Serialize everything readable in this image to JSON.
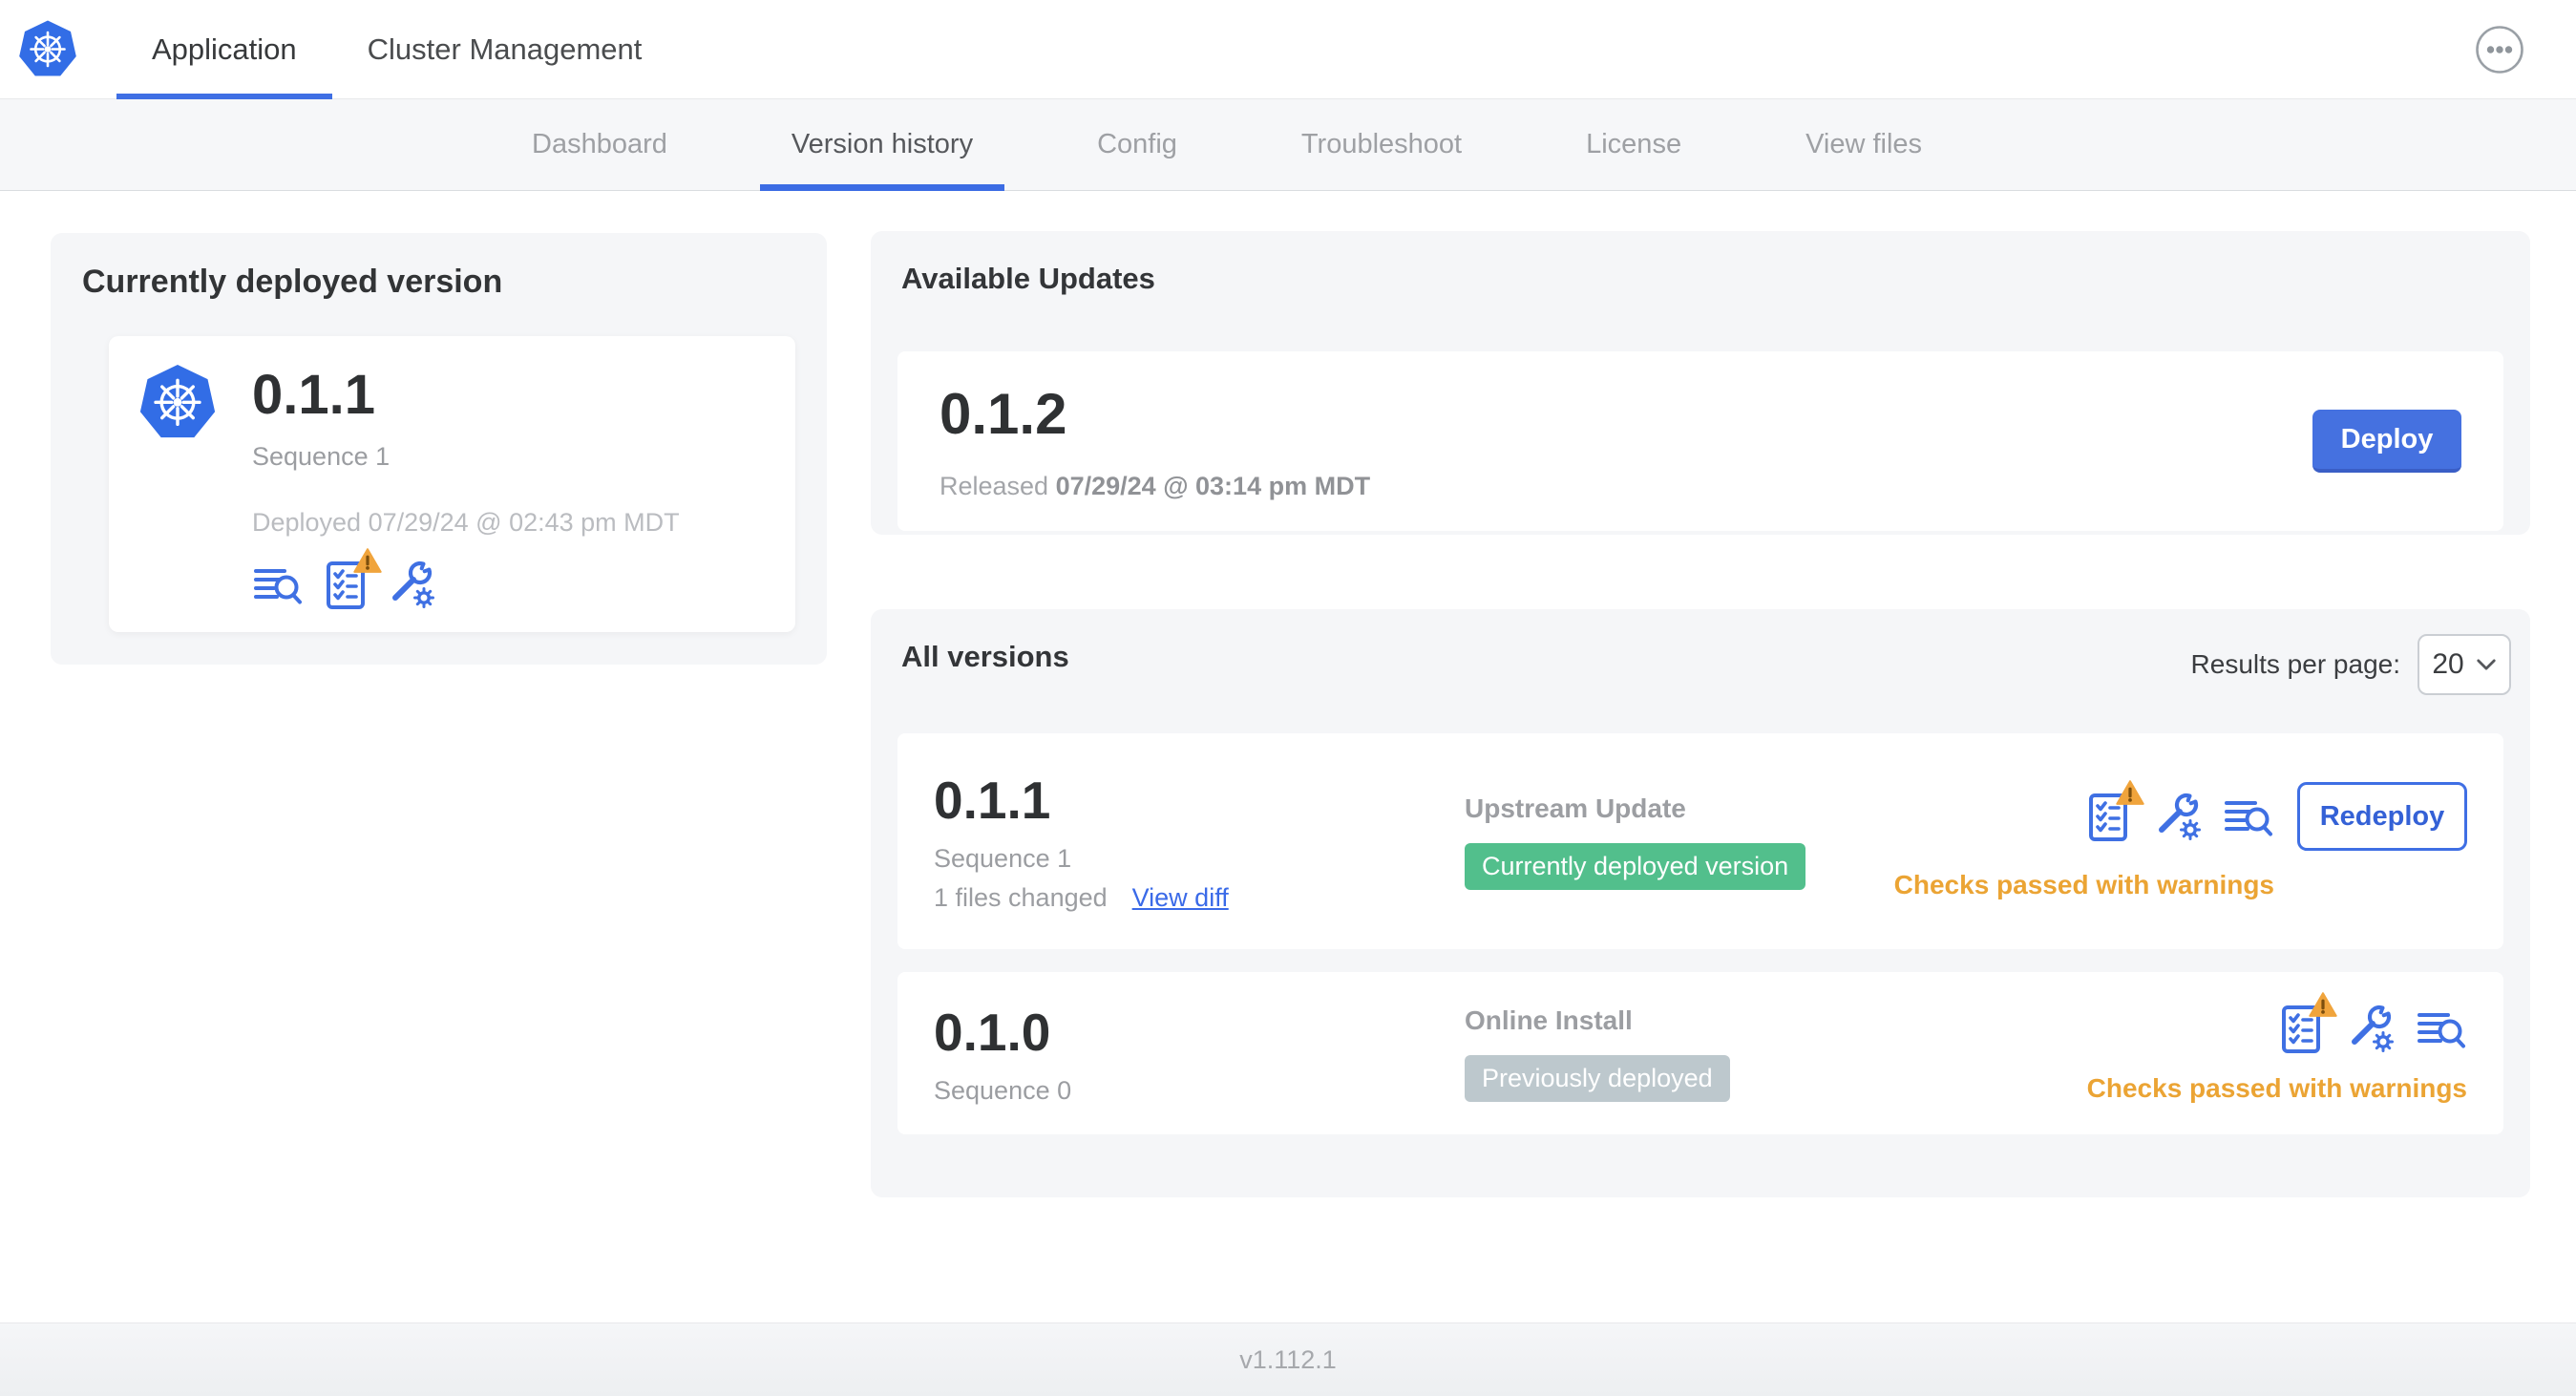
{
  "header": {
    "tabs": [
      {
        "label": "Application",
        "active": true
      },
      {
        "label": "Cluster Management",
        "active": false
      }
    ],
    "menu_icon": "ellipsis-menu-icon",
    "logo_icon": "kubernetes-logo"
  },
  "subnav": {
    "items": [
      {
        "label": "Dashboard",
        "active": false
      },
      {
        "label": "Version history",
        "active": true
      },
      {
        "label": "Config",
        "active": false
      },
      {
        "label": "Troubleshoot",
        "active": false
      },
      {
        "label": "License",
        "active": false
      },
      {
        "label": "View files",
        "active": false
      }
    ]
  },
  "deployed_card": {
    "title": "Currently deployed version",
    "version": "0.1.1",
    "sequence": "Sequence 1",
    "deployed_at": "Deployed 07/29/24 @ 02:43 pm MDT",
    "icons": [
      "release-notes-icon",
      "preflight-checks-warning-icon",
      "config-values-icon"
    ]
  },
  "available_updates": {
    "title": "Available Updates",
    "version": "0.1.2",
    "released_prefix": "Released",
    "released_date": "07/29/24 @ 03:14 pm MDT",
    "deploy_label": "Deploy"
  },
  "all_versions": {
    "title": "All versions",
    "results_per_page_label": "Results per page:",
    "results_per_page_value": "20",
    "rows": [
      {
        "version": "0.1.1",
        "sequence": "Sequence 1",
        "files_changed": "1 files changed",
        "view_diff_label": "View diff",
        "source": "Upstream Update",
        "status_label": "Currently deployed version",
        "status_type": "success",
        "checks_text": "Checks passed with warnings",
        "action_label": "Redeploy",
        "icons": [
          "preflight-checks-warning-icon",
          "config-values-icon",
          "release-notes-icon"
        ]
      },
      {
        "version": "0.1.0",
        "sequence": "Sequence 0",
        "source": "Online Install",
        "status_label": "Previously deployed",
        "status_type": "muted",
        "checks_text": "Checks passed with warnings",
        "icons": [
          "preflight-checks-warning-icon",
          "config-values-icon",
          "release-notes-icon"
        ]
      }
    ]
  },
  "footer": {
    "app_version": "v1.112.1"
  },
  "colors": {
    "accent_blue": "#3f70e3",
    "kubernetes_blue": "#326de6",
    "success_green": "#52bf8c",
    "muted_badge_gray": "#bdc8cd",
    "warning_amber": "#eba434"
  }
}
